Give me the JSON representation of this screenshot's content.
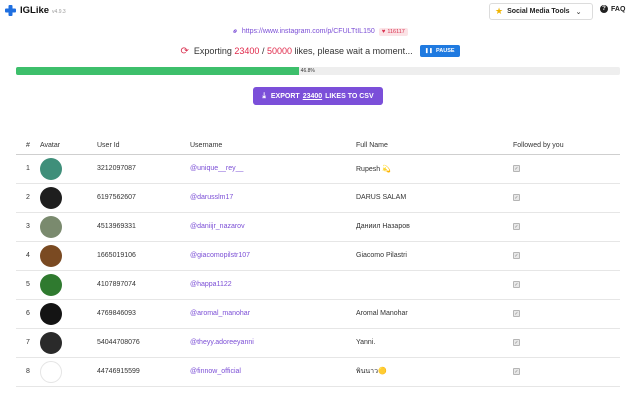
{
  "header": {
    "app_name": "IGLike",
    "version": "v4.9.3",
    "tools_label": "Social Media Tools",
    "faq_label": "FAQ"
  },
  "post": {
    "url": "https://www.instagram.com/p/CFULTtIL150",
    "likes_count": "116117"
  },
  "status": {
    "prefix": "Exporting",
    "current": "23400",
    "separator": "/",
    "total": "50000",
    "suffix": "likes, please wait a moment...",
    "pause_label": "PAUSE"
  },
  "progress": {
    "percent": 46.8,
    "label": "46.8%"
  },
  "export": {
    "prefix": "EXPORT",
    "count": "23400",
    "suffix": "LIKES TO CSV"
  },
  "table": {
    "columns": [
      "#",
      "Avatar",
      "User Id",
      "Username",
      "Full Name",
      "Followed by you"
    ],
    "rows": [
      {
        "idx": "1",
        "user_id": "3212097087",
        "username": "@unique__rey__",
        "full_name": "Rupesh 💫",
        "avatar_color": "#3f8f7a",
        "followed": true
      },
      {
        "idx": "2",
        "user_id": "6197562607",
        "username": "@darusslm17",
        "full_name": "DARUS SALAM",
        "avatar_color": "#1e1e1e",
        "followed": true
      },
      {
        "idx": "3",
        "user_id": "4513969331",
        "username": "@daniijr_nazarov",
        "full_name": "Даниил Назаров",
        "avatar_color": "#7a8a6e",
        "followed": true
      },
      {
        "idx": "4",
        "user_id": "1665019106",
        "username": "@giacomopilstr107",
        "full_name": "Giacomo Pilastri",
        "avatar_color": "#7a4a22",
        "followed": true
      },
      {
        "idx": "5",
        "user_id": "4107897074",
        "username": "@happa1122",
        "full_name": "",
        "avatar_color": "#2f7a2f",
        "followed": true
      },
      {
        "idx": "6",
        "user_id": "4769846093",
        "username": "@aromal_manohar",
        "full_name": "Aromal Manohar",
        "avatar_color": "#141414",
        "followed": true
      },
      {
        "idx": "7",
        "user_id": "54044708076",
        "username": "@theyy.adoreeyanni",
        "full_name": "Yanni.",
        "avatar_color": "#2a2a2a",
        "followed": true
      },
      {
        "idx": "8",
        "user_id": "44746915599",
        "username": "@finnow_official",
        "full_name": "พินนาว🟡",
        "avatar_color": "#ffffff",
        "followed": true
      }
    ]
  },
  "colors": {
    "accent_purple": "#7b4fd9",
    "red": "#e0284a",
    "progress_green": "#3dbf6b",
    "pause_blue": "#1f7ae0"
  }
}
